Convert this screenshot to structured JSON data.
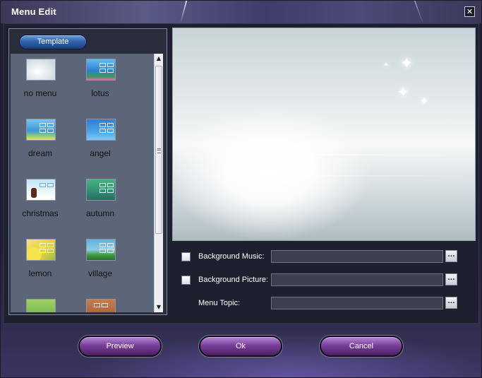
{
  "window": {
    "title": "Menu Edit",
    "close_glyph": "✕"
  },
  "template_tab": {
    "label": "Template"
  },
  "templates": [
    {
      "label": "no menu",
      "icon": "no-menu-thumbnail"
    },
    {
      "label": "lotus",
      "icon": "lotus-thumbnail"
    },
    {
      "label": "dream",
      "icon": "dream-thumbnail"
    },
    {
      "label": "angel",
      "icon": "angel-thumbnail"
    },
    {
      "label": "christmas",
      "icon": "christmas-thumbnail"
    },
    {
      "label": "autumn",
      "icon": "autumn-thumbnail"
    },
    {
      "label": "lemon",
      "icon": "lemon-thumbnail"
    },
    {
      "label": "village",
      "icon": "village-thumbnail"
    }
  ],
  "scroll_glyphs": {
    "up": "▲",
    "down": "▼"
  },
  "options": {
    "background_music": {
      "label": "Background Music:",
      "checked": false,
      "value": ""
    },
    "background_picture": {
      "label": "Background Picture:",
      "checked": false,
      "value": ""
    },
    "menu_topic": {
      "label": "Menu Topic:",
      "value": ""
    },
    "browse_glyph": "..."
  },
  "buttons": {
    "preview": "Preview",
    "ok": "Ok",
    "cancel": "Cancel"
  },
  "colors": {
    "accent_purple": "#7a3f9c",
    "template_blue": "#2f63ad",
    "panel_bg": "#5c6678"
  }
}
